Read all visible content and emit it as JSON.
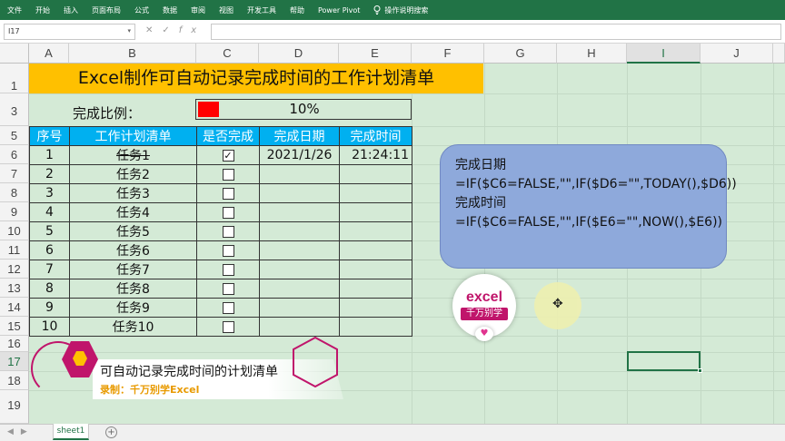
{
  "ribbon": {
    "tabs": [
      "文件",
      "开始",
      "插入",
      "页面布局",
      "公式",
      "数据",
      "审阅",
      "视图",
      "开发工具",
      "帮助",
      "Power Pivot"
    ],
    "tell_me": "操作说明搜索"
  },
  "formula_bar": {
    "name_box": "I17",
    "formula": ""
  },
  "columns": [
    "A",
    "B",
    "C",
    "D",
    "E",
    "F",
    "G",
    "H",
    "I",
    "J"
  ],
  "rows": [
    "1",
    "3",
    "5",
    "6",
    "7",
    "8",
    "9",
    "10",
    "11",
    "12",
    "13",
    "14",
    "15",
    "16",
    "17",
    "18",
    "19"
  ],
  "sheet": {
    "title": "Excel制作可自动记录完成时间的工作计划清单",
    "ratio_label": "完成比例：",
    "ratio_text": "10%",
    "ratio_value": 0.1,
    "headers": [
      "序号",
      "工作计划清单",
      "是否完成",
      "完成日期",
      "完成时间"
    ],
    "tasks": [
      {
        "no": "1",
        "name": "任务1",
        "checked": true,
        "date": "2021/1/26",
        "time": "21:24:11"
      },
      {
        "no": "2",
        "name": "任务2",
        "checked": false,
        "date": "",
        "time": ""
      },
      {
        "no": "3",
        "name": "任务3",
        "checked": false,
        "date": "",
        "time": ""
      },
      {
        "no": "4",
        "name": "任务4",
        "checked": false,
        "date": "",
        "time": ""
      },
      {
        "no": "5",
        "name": "任务5",
        "checked": false,
        "date": "",
        "time": ""
      },
      {
        "no": "6",
        "name": "任务6",
        "checked": false,
        "date": "",
        "time": ""
      },
      {
        "no": "7",
        "name": "任务7",
        "checked": false,
        "date": "",
        "time": ""
      },
      {
        "no": "8",
        "name": "任务8",
        "checked": false,
        "date": "",
        "time": ""
      },
      {
        "no": "9",
        "name": "任务9",
        "checked": false,
        "date": "",
        "time": ""
      },
      {
        "no": "10",
        "name": "任务10",
        "checked": false,
        "date": "",
        "time": ""
      }
    ]
  },
  "callout": {
    "line1": "完成日期",
    "line2": "=IF($C6=FALSE,\"\",IF($D6=\"\",TODAY(),$D6))",
    "line3": "完成时间",
    "line4": "=IF($C6=FALSE,\"\",IF($E6=\"\",NOW(),$E6))"
  },
  "logo": {
    "line1": "excel",
    "line2": "千万别学"
  },
  "banner": {
    "title": "可自动记录完成时间的计划清单",
    "subtitle": "录制：千万别学Excel"
  },
  "tabs": {
    "sheet_name": "sheet1"
  },
  "colors": {
    "ribbon": "#217346",
    "title_bg": "#ffc000",
    "header_bg": "#00b0f0",
    "grid_bg": "#d4ead6",
    "callout_bg": "#8ea9db",
    "brand": "#c0156b"
  }
}
